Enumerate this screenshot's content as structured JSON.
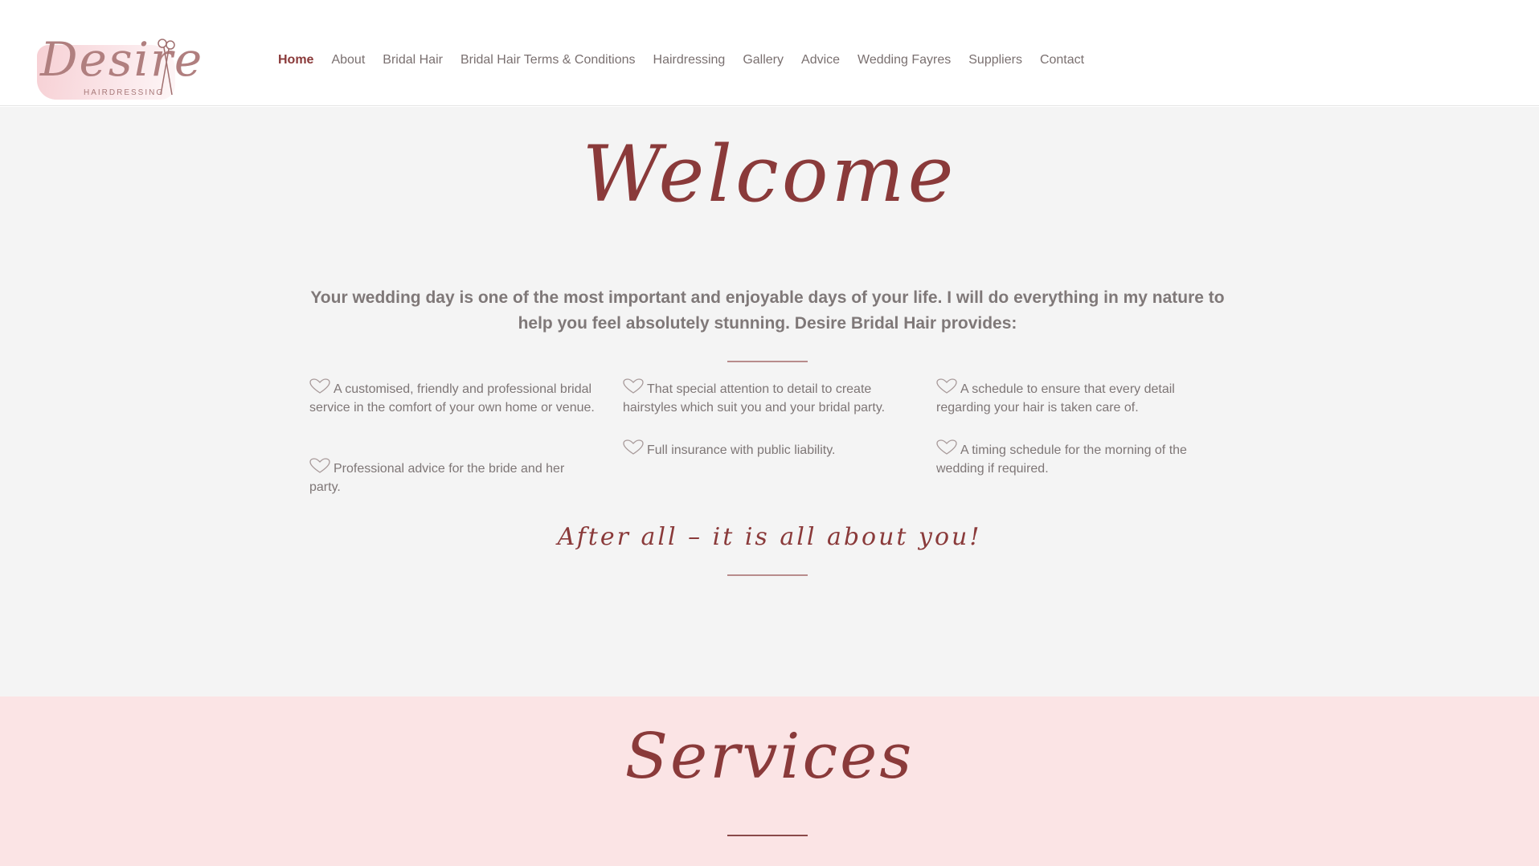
{
  "brand": {
    "logo_script": "Desire",
    "logo_sub": "HAIRDRESSING",
    "accent_color": "#8a3a3a",
    "pink_color": "#fbe4e5"
  },
  "nav": {
    "items": [
      {
        "label": "Home",
        "active": true
      },
      {
        "label": "About",
        "active": false
      },
      {
        "label": "Bridal Hair",
        "active": false
      },
      {
        "label": "Bridal Hair Terms & Conditions",
        "active": false
      },
      {
        "label": "Hairdressing",
        "active": false
      },
      {
        "label": "Gallery",
        "active": false
      },
      {
        "label": "Advice",
        "active": false
      },
      {
        "label": "Wedding Fayres",
        "active": false
      },
      {
        "label": "Suppliers",
        "active": false
      },
      {
        "label": "Contact",
        "active": false
      }
    ]
  },
  "welcome": {
    "title": "Welcome",
    "intro": "Your wedding day is one of the most important and enjoyable days of your life. I will do everything in my nature to help you feel absolutely stunning. Desire Bridal Hair provides:",
    "features": [
      {
        "text": "A customised, friendly and professional bridal service in the comfort of your own home or venue.",
        "icon": "heart-icon"
      },
      {
        "text": "That special attention to detail to create hairstyles which suit you and your bridal party.",
        "icon": "heart-icon"
      },
      {
        "text": "A schedule to ensure that every detail regarding your hair is taken care of.",
        "icon": "heart-icon"
      },
      {
        "text": "Professional advice for the bride and her party.",
        "icon": "heart-icon"
      },
      {
        "text": "Full insurance with public liability.",
        "icon": "heart-icon"
      },
      {
        "text": "A timing schedule for the morning of the wedding if required.",
        "icon": "heart-icon"
      }
    ],
    "tagline": "After all – it is all about you!"
  },
  "services": {
    "title": "Services"
  }
}
